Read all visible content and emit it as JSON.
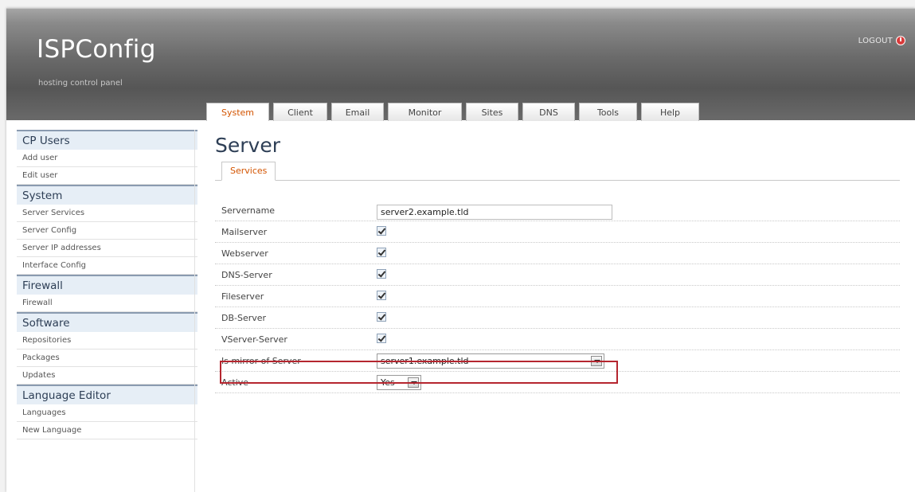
{
  "header": {
    "logo": "ISPConfig",
    "tagline": "hosting control panel",
    "logout_label": "LOGOUT"
  },
  "tabs": [
    {
      "label": "System",
      "active": true
    },
    {
      "label": "Client",
      "active": false
    },
    {
      "label": "Email",
      "active": false
    },
    {
      "label": "Monitor",
      "active": false
    },
    {
      "label": "Sites",
      "active": false
    },
    {
      "label": "DNS",
      "active": false
    },
    {
      "label": "Tools",
      "active": false
    },
    {
      "label": "Help",
      "active": false
    }
  ],
  "sidebar": {
    "sections": [
      {
        "title": "CP Users",
        "items": [
          "Add user",
          "Edit user"
        ]
      },
      {
        "title": "System",
        "items": [
          "Server Services",
          "Server Config",
          "Server IP addresses",
          "Interface Config"
        ]
      },
      {
        "title": "Firewall",
        "items": [
          "Firewall"
        ]
      },
      {
        "title": "Software",
        "items": [
          "Repositories",
          "Packages",
          "Updates"
        ]
      },
      {
        "title": "Language Editor",
        "items": [
          "Languages",
          "New Language"
        ]
      }
    ]
  },
  "main": {
    "title": "Server",
    "subtab": "Services",
    "form": {
      "servername": {
        "label": "Servername",
        "value": "server2.example.tld"
      },
      "mailserver": {
        "label": "Mailserver",
        "checked": true
      },
      "webserver": {
        "label": "Webserver",
        "checked": true
      },
      "dnsserver": {
        "label": "DNS-Server",
        "checked": true
      },
      "fileserver": {
        "label": "Fileserver",
        "checked": true
      },
      "dbserver": {
        "label": "DB-Server",
        "checked": true
      },
      "vserver": {
        "label": "VServer-Server",
        "checked": true
      },
      "mirror": {
        "label": "Is mirror of Server",
        "value": "server1.example.tld"
      },
      "active": {
        "label": "Active",
        "value": "Yes"
      }
    }
  },
  "colors": {
    "accent_orange": "#d35400",
    "highlight_red": "#b5262f",
    "sidebar_head_bg": "#e6eef6"
  }
}
